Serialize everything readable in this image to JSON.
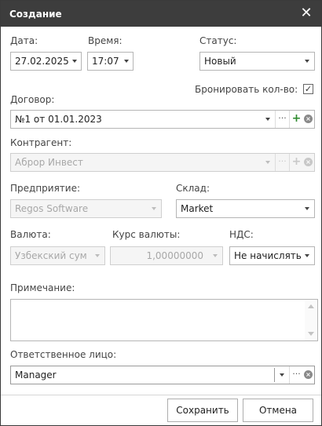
{
  "window": {
    "title": "Создание",
    "close_icon": "close-icon"
  },
  "date": {
    "label": "Дата:",
    "value": "27.02.2025"
  },
  "time": {
    "label": "Время:",
    "value": "17:07"
  },
  "status": {
    "label": "Статус:",
    "value": "Новый"
  },
  "reserve": {
    "label": "Бронировать кол-во:",
    "checked": true,
    "mark": "✓"
  },
  "contract": {
    "label": "Договор:",
    "value": "№1 от 01.01.2023",
    "more": "···",
    "add": "+",
    "clear": "×"
  },
  "counterparty": {
    "label": "Контрагент:",
    "value": "Аброр Инвест",
    "more": "···",
    "add": "+",
    "clear": "×",
    "disabled": true
  },
  "enterprise": {
    "label": "Предприятие:",
    "value": "Regos Software",
    "disabled": true
  },
  "warehouse": {
    "label": "Склад:",
    "value": "Market"
  },
  "currency": {
    "label": "Валюта:",
    "value": "Узбекский сум",
    "disabled": true
  },
  "rate": {
    "label": "Курс валюты:",
    "value": "1,00000000",
    "disabled": true
  },
  "vat": {
    "label": "НДС:",
    "value": "Не начислять"
  },
  "note": {
    "label": "Примечание:",
    "value": ""
  },
  "responsible": {
    "label": "Ответственное лицо:",
    "value": "Manager",
    "more": "···",
    "clear": "×"
  },
  "buttons": {
    "save": "Сохранить",
    "cancel": "Отмена"
  }
}
